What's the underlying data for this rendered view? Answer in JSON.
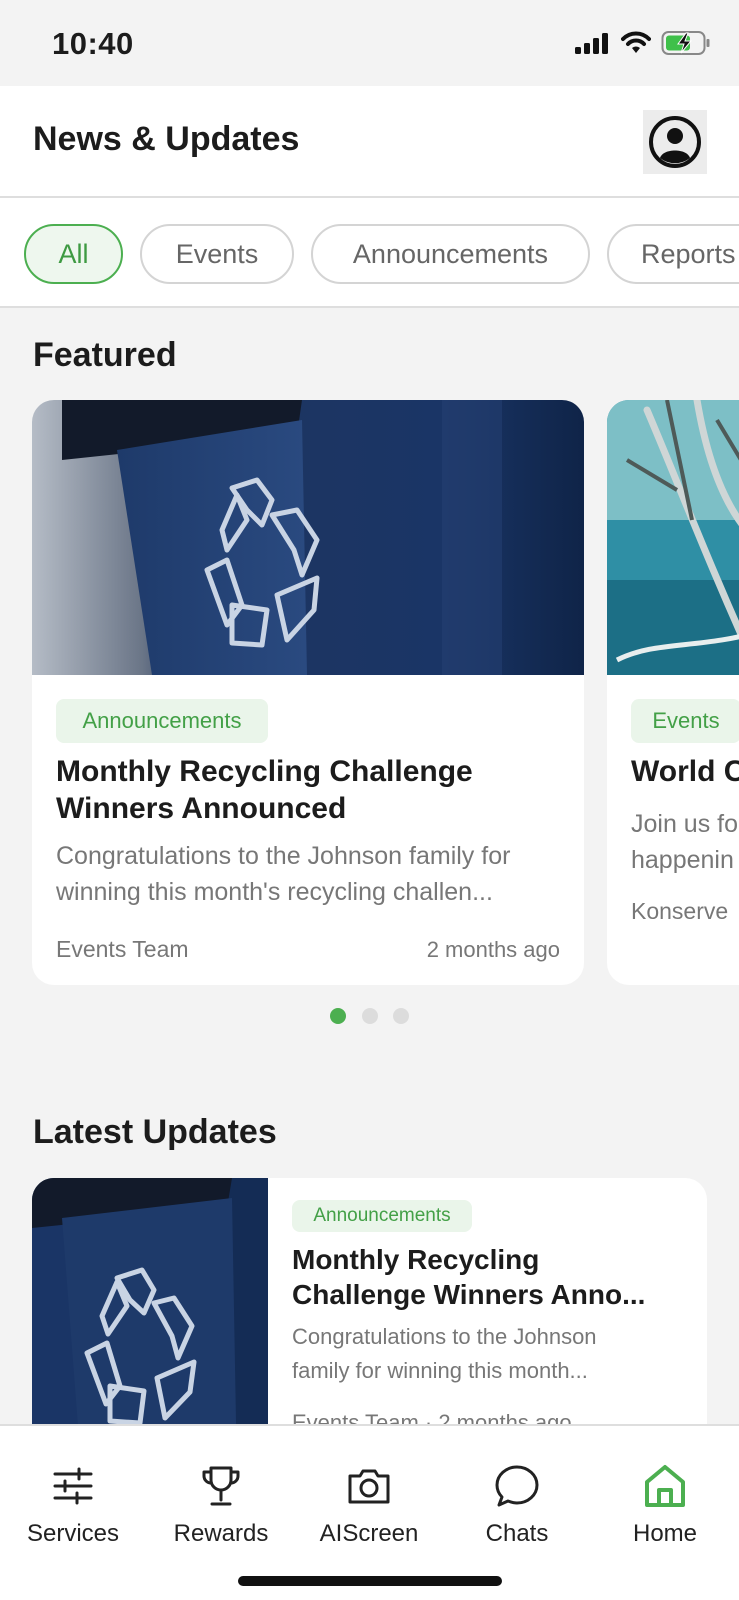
{
  "status_bar": {
    "time": "10:40"
  },
  "header": {
    "title": "News & Updates"
  },
  "filters": [
    "All",
    "Events",
    "Announcements",
    "Reports"
  ],
  "featured": {
    "title": "Featured",
    "cards": [
      {
        "tag": "Announcements",
        "title_line1": "Monthly Recycling Challenge",
        "title_line2": "Winners Announced",
        "excerpt_line1": "Congratulations to the Johnson family for",
        "excerpt_line2": "winning this month's recycling challen...",
        "author": "Events Team",
        "time": "2 months ago"
      },
      {
        "tag": "Events",
        "title_line1": "World C",
        "excerpt_line1": "Join us fo",
        "excerpt_line2": "happenin",
        "author": "Konserve"
      }
    ],
    "pagination": {
      "current": 1,
      "total": 3
    }
  },
  "latest": {
    "title": "Latest Updates",
    "item": {
      "tag": "Announcements",
      "title_line1": "Monthly Recycling",
      "title_line2": "Challenge Winners Anno...",
      "excerpt_line1": "Congratulations to the Johnson",
      "excerpt_line2": "family for winning this month...",
      "meta_partial": "Events Team · 2 months ago"
    }
  },
  "nav": {
    "services": "Services",
    "rewards": "Rewards",
    "aiscreen": "AIScreen",
    "chats": "Chats",
    "home": "Home"
  },
  "colors": {
    "accent": "#4caf50",
    "tag_bg": "#eaf5ea",
    "tag_text": "#43a047",
    "bin_blue": "#15305a"
  }
}
